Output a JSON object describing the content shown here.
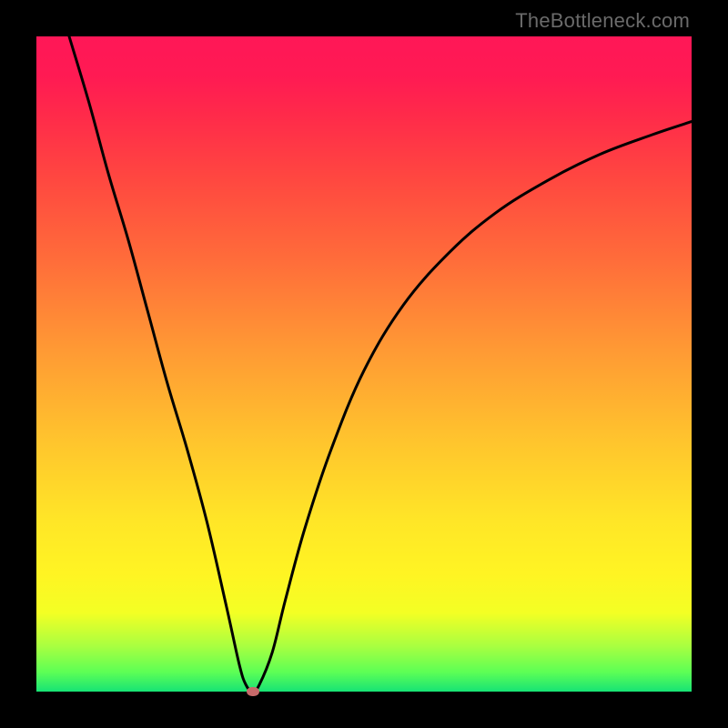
{
  "watermark": "TheBottleneck.com",
  "chart_data": {
    "type": "line",
    "title": "",
    "xlabel": "",
    "ylabel": "",
    "xlim": [
      0,
      100
    ],
    "ylim": [
      0,
      100
    ],
    "grid": false,
    "series": [
      {
        "name": "bottleneck-curve",
        "x": [
          5,
          8,
          11,
          14,
          17,
          20,
          23,
          26,
          29,
          31,
          32,
          33,
          34,
          36,
          38,
          41,
          45,
          50,
          56,
          63,
          70,
          78,
          86,
          94,
          100
        ],
        "values": [
          100,
          90,
          79,
          69,
          58,
          47,
          37,
          26,
          13,
          4,
          1,
          0,
          1,
          6,
          14,
          25,
          37,
          49,
          59,
          67,
          73,
          78,
          82,
          85,
          87
        ]
      }
    ],
    "minimum_marker": {
      "x": 33,
      "y": 0
    },
    "background_gradient": {
      "orientation": "vertical",
      "stops": [
        {
          "pos": 0.0,
          "color": "#ff1757"
        },
        {
          "pos": 0.22,
          "color": "#ff4840"
        },
        {
          "pos": 0.48,
          "color": "#ff9a34"
        },
        {
          "pos": 0.74,
          "color": "#ffe627"
        },
        {
          "pos": 0.93,
          "color": "#aaff40"
        },
        {
          "pos": 1.0,
          "color": "#17e375"
        }
      ]
    }
  }
}
